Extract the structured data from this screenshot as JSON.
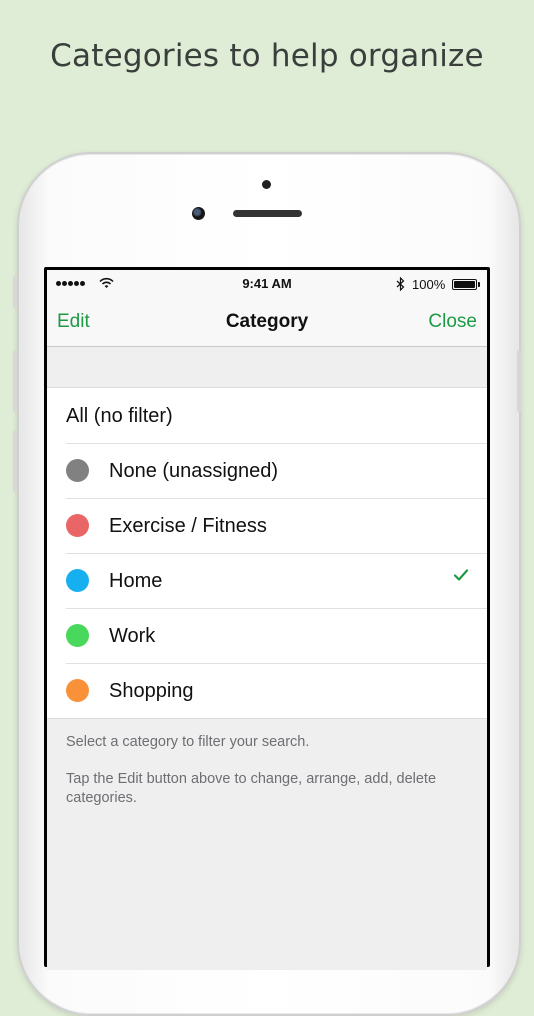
{
  "headline": "Categories to help organize",
  "status_bar": {
    "time": "9:41 AM",
    "battery": "100%"
  },
  "nav": {
    "left": "Edit",
    "title": "Category",
    "right": "Close"
  },
  "rows": [
    {
      "label": "All (no filter)",
      "color": null,
      "checked": false
    },
    {
      "label": "None (unassigned)",
      "color": "#818181",
      "checked": false
    },
    {
      "label": "Exercise / Fitness",
      "color": "#e96566",
      "checked": false
    },
    {
      "label": "Home",
      "color": "#16aff0",
      "checked": true
    },
    {
      "label": "Work",
      "color": "#48d85c",
      "checked": false
    },
    {
      "label": "Shopping",
      "color": "#f99139",
      "checked": false
    }
  ],
  "footer": {
    "line1": "Select a category to filter your search.",
    "line2": "Tap the Edit button above to change, arrange, add, delete categories."
  },
  "accent_color": "#1e9a45"
}
